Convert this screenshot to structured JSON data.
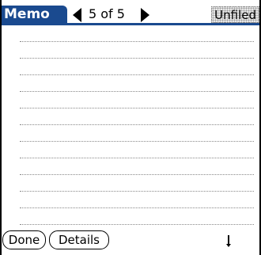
{
  "app": {
    "title": "Memo"
  },
  "navigation": {
    "record_position": "5 of 5"
  },
  "category": {
    "label": "Unfiled"
  },
  "memo": {
    "text": "",
    "line_count": 12
  },
  "buttons": {
    "done": "Done",
    "details": "Details"
  },
  "colors": {
    "title_bar": "#1a4a8f",
    "background": "#ffffff"
  }
}
